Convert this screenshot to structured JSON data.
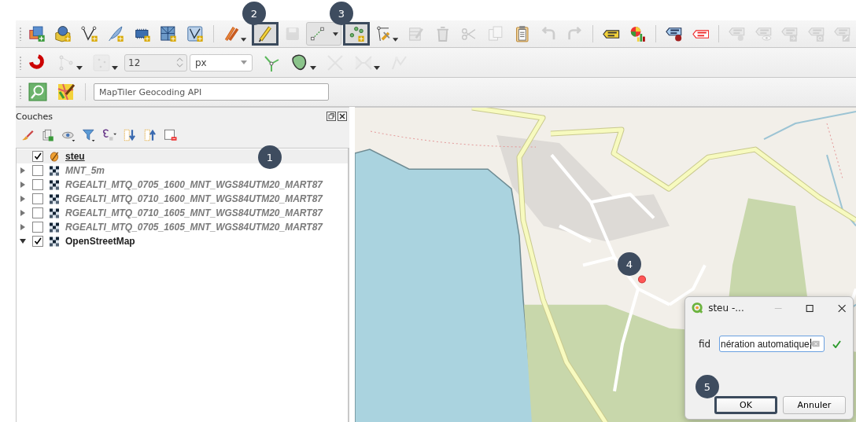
{
  "toolbars": [
    {
      "items": [
        {
          "kind": "icon",
          "disabled": false,
          "highlighted": false
        },
        {
          "kind": "icon",
          "disabled": false,
          "highlighted": false
        },
        {
          "kind": "icon",
          "disabled": false,
          "highlighted": false
        },
        {
          "kind": "icon",
          "disabled": false,
          "highlighted": false
        },
        {
          "kind": "icon",
          "disabled": false,
          "highlighted": false
        },
        {
          "kind": "icon",
          "disabled": false,
          "highlighted": false
        },
        {
          "kind": "icon",
          "disabled": false,
          "highlighted": false
        },
        {
          "kind": "separator"
        },
        {
          "kind": "dropdown",
          "disabled": false,
          "highlighted": false
        },
        {
          "kind": "icon",
          "disabled": false,
          "highlighted": true
        },
        {
          "kind": "icon",
          "disabled": true,
          "highlighted": false
        },
        {
          "kind": "split",
          "disabled": false,
          "highlighted": false
        },
        {
          "kind": "icon",
          "disabled": false,
          "highlighted": true
        },
        {
          "kind": "dropdown",
          "disabled": false,
          "highlighted": false
        },
        {
          "kind": "icon",
          "disabled": true,
          "highlighted": false
        },
        {
          "kind": "icon",
          "disabled": true,
          "highlighted": false
        },
        {
          "kind": "icon",
          "disabled": true,
          "highlighted": false
        },
        {
          "kind": "icon",
          "disabled": true,
          "highlighted": false
        },
        {
          "kind": "icon",
          "disabled": false,
          "highlighted": false
        },
        {
          "kind": "icon",
          "disabled": true,
          "highlighted": false
        },
        {
          "kind": "icon",
          "disabled": true,
          "highlighted": false
        },
        {
          "kind": "separator"
        },
        {
          "kind": "icon",
          "disabled": false,
          "highlighted": false
        },
        {
          "kind": "icon",
          "disabled": false,
          "highlighted": false
        },
        {
          "kind": "separator"
        },
        {
          "kind": "icon",
          "disabled": false,
          "highlighted": false
        },
        {
          "kind": "icon",
          "disabled": false,
          "highlighted": false
        },
        {
          "kind": "separator"
        },
        {
          "kind": "icon",
          "disabled": true,
          "highlighted": false
        },
        {
          "kind": "icon",
          "disabled": true,
          "highlighted": false
        },
        {
          "kind": "icon",
          "disabled": true,
          "highlighted": false
        },
        {
          "kind": "icon",
          "disabled": true,
          "highlighted": false
        },
        {
          "kind": "icon",
          "disabled": true,
          "highlighted": false
        }
      ]
    },
    {
      "items": [
        {
          "kind": "icon",
          "disabled": false,
          "highlighted": false
        },
        {
          "kind": "dropdown",
          "disabled": true,
          "highlighted": false
        },
        {
          "kind": "dropdown",
          "disabled": true,
          "highlighted": false
        },
        {
          "kind": "spinbox",
          "disabled": true,
          "value": "12"
        },
        {
          "kind": "combo",
          "disabled": false,
          "value": "px"
        },
        {
          "kind": "icon",
          "disabled": false,
          "highlighted": false
        },
        {
          "kind": "dropdown",
          "disabled": false,
          "highlighted": false
        },
        {
          "kind": "icon",
          "disabled": true,
          "highlighted": false
        },
        {
          "kind": "dropdown",
          "disabled": true,
          "highlighted": false
        },
        {
          "kind": "icon",
          "disabled": true,
          "highlighted": false
        }
      ]
    },
    {
      "items": [
        {
          "kind": "icon",
          "disabled": false,
          "highlighted": false
        },
        {
          "kind": "icon",
          "disabled": false,
          "highlighted": false
        },
        {
          "kind": "separator"
        },
        {
          "kind": "search",
          "placeholder": "MapTiler Geocoding API"
        }
      ]
    }
  ],
  "layers_panel": {
    "title": "Couches",
    "layers": [
      {
        "name": "steu",
        "kind": "vector",
        "expandable": false,
        "checked": true,
        "selected": true,
        "editing": true,
        "greyed": false
      },
      {
        "name": "MNT_5m",
        "kind": "raster",
        "expandable": true,
        "expanded": false,
        "checked": false,
        "selected": false,
        "editing": false,
        "greyed": true
      },
      {
        "name": "RGEALTI_MTQ_0705_1600_MNT_WGS84UTM20_MART87",
        "kind": "raster",
        "expandable": true,
        "expanded": false,
        "checked": false,
        "selected": false,
        "editing": false,
        "greyed": true
      },
      {
        "name": "RGEALTI_MTQ_0710_1600_MNT_WGS84UTM20_MART87",
        "kind": "raster",
        "expandable": true,
        "expanded": false,
        "checked": false,
        "selected": false,
        "editing": false,
        "greyed": true
      },
      {
        "name": "RGEALTI_MTQ_0710_1605_MNT_WGS84UTM20_MART87",
        "kind": "raster",
        "expandable": true,
        "expanded": false,
        "checked": false,
        "selected": false,
        "editing": false,
        "greyed": true
      },
      {
        "name": "RGEALTI_MTQ_0705_1605_MNT_WGS84UTM20_MART87",
        "kind": "raster",
        "expandable": true,
        "expanded": false,
        "checked": false,
        "selected": false,
        "editing": false,
        "greyed": true
      },
      {
        "name": "OpenStreetMap",
        "kind": "raster",
        "expandable": true,
        "expanded": true,
        "checked": true,
        "selected": false,
        "editing": false,
        "greyed": false
      }
    ]
  },
  "dialog": {
    "title": "steu -...",
    "field_label": "fid",
    "field_value": "nération automatique",
    "valid": true,
    "buttons": [
      {
        "label": "OK",
        "highlighted": true
      },
      {
        "label": "Annuler",
        "highlighted": false
      }
    ]
  },
  "callouts": [
    {
      "label": "1"
    },
    {
      "label": "2"
    },
    {
      "label": "3"
    },
    {
      "label": "4"
    },
    {
      "label": "5"
    }
  ]
}
